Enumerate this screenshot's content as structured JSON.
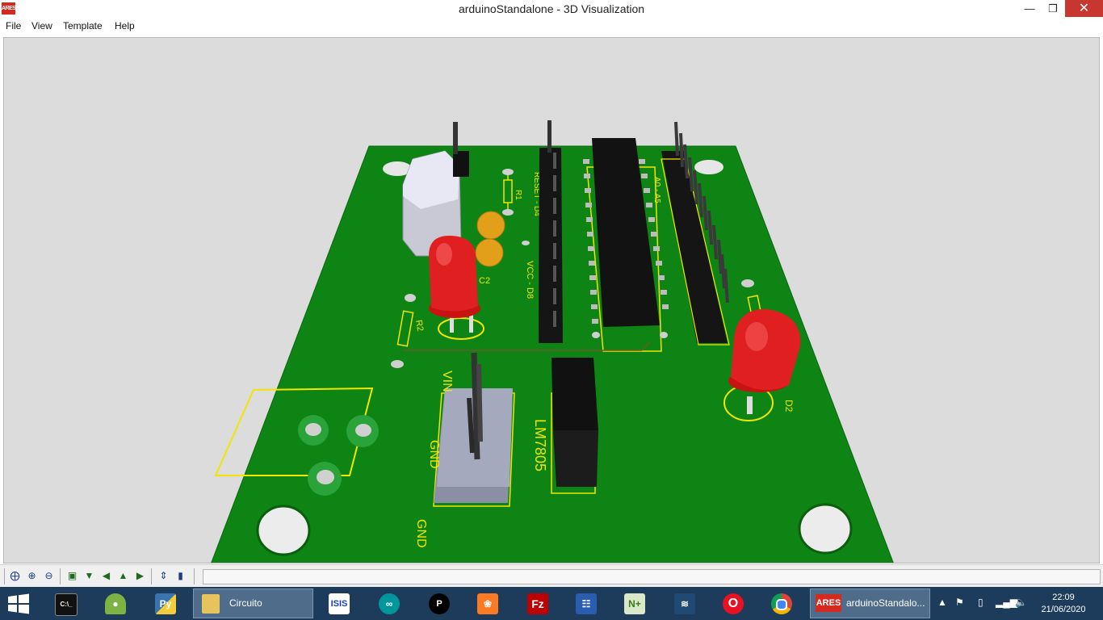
{
  "window": {
    "app_icon": "ARES",
    "title": "arduinoStandalone - 3D Visualization",
    "minimize_icon": "minimize-icon",
    "maximize_icon": "restore-icon",
    "close_icon": "close-icon"
  },
  "menu": [
    "File",
    "View",
    "Template",
    "Help"
  ],
  "board": {
    "silkscreen": {
      "reset_d4": "RESET - D4",
      "a0_a5": "A0 - A5",
      "vcc_d8": "VCC - D8",
      "vin": "VIN",
      "gnd_mid": "GND",
      "gnd": "GND",
      "lm7805": "LM7805",
      "r1": "R1",
      "r2": "R2",
      "c2": "C2",
      "d2": "D2"
    },
    "colors": {
      "pcb": "#0d8413",
      "silkscreen": "#f2e600",
      "led": "#d81515",
      "background": "#dcdcdc"
    }
  },
  "toolbar": {
    "icons": [
      "pan-icon",
      "zoom-in-icon",
      "zoom-out-icon",
      "view-top-icon",
      "view-front-icon",
      "view-left-icon",
      "view-back-icon",
      "view-right-icon",
      "toggle-height-icon",
      "toggle-components-icon"
    ],
    "status_text": ""
  },
  "taskbar": {
    "apps": [
      "cmd",
      "android-studio",
      "python",
      "isis",
      "arduino",
      "pycharm",
      "xampp",
      "filezilla",
      "network-tool",
      "notepad-plus",
      "mysql-workbench",
      "opera",
      "chrome"
    ],
    "windows": [
      {
        "label": "Circuito",
        "icon": "folder-icon"
      },
      {
        "label": "arduinoStandalo...",
        "icon": "ares-icon"
      }
    ],
    "clock_time": "22:09",
    "clock_date": "21/06/2020"
  }
}
